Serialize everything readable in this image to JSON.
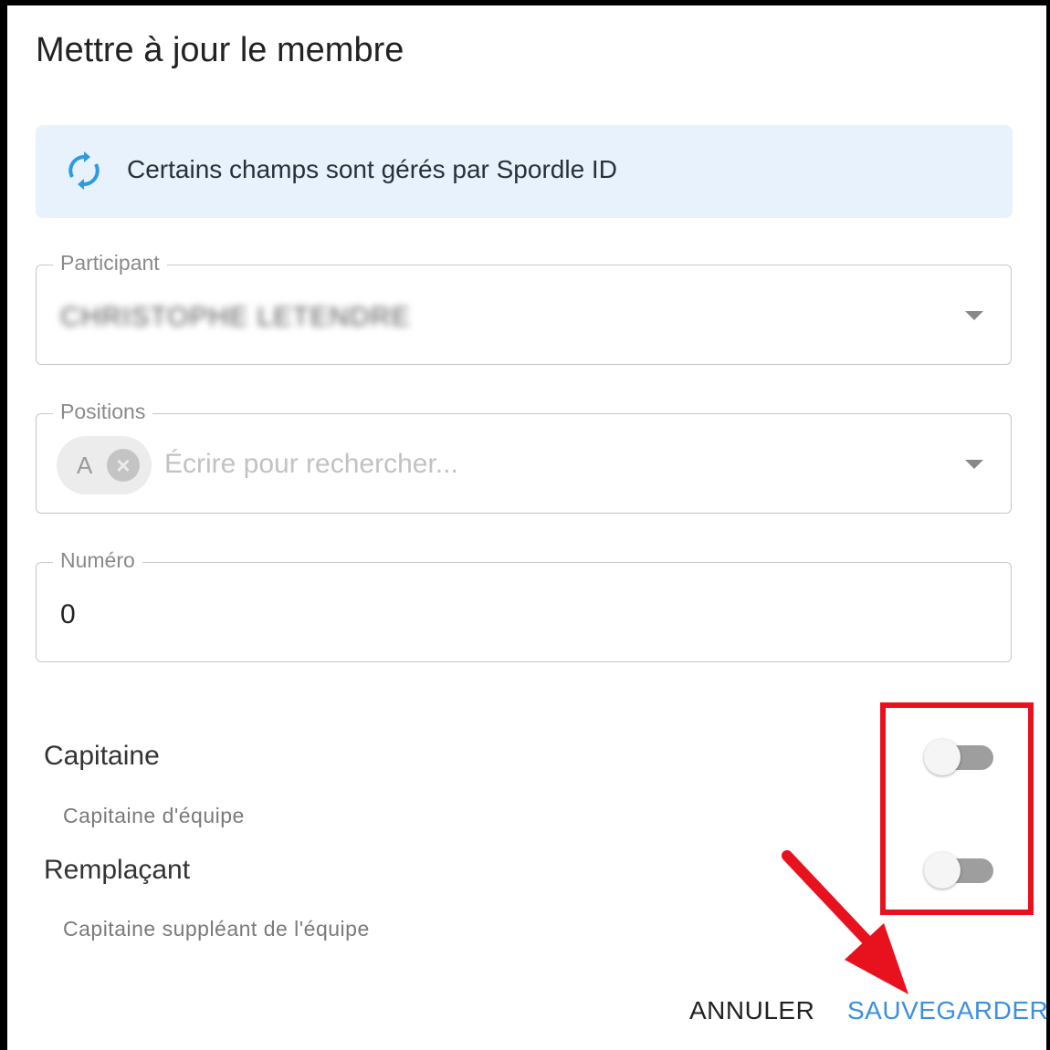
{
  "dialog": {
    "title": "Mettre à jour le membre",
    "info_banner": {
      "icon": "sync-icon",
      "text": "Certains champs sont gérés par Spordle ID"
    },
    "participant_field": {
      "label": "Participant",
      "value": "CHRISTOPHE LETENDRE"
    },
    "positions_field": {
      "label": "Positions",
      "chips": [
        "A"
      ],
      "placeholder": "Écrire pour rechercher..."
    },
    "number_field": {
      "label": "Numéro",
      "value": "0"
    },
    "captain": {
      "label": "Capitaine",
      "help": "Capitaine d'équipe",
      "enabled": false
    },
    "substitute": {
      "label": "Remplaçant",
      "help": "Capitaine suppléant de l'équipe",
      "enabled": false
    },
    "actions": {
      "cancel": "ANNULER",
      "save": "SAUVEGARDER"
    }
  },
  "colors": {
    "accent": "#3d8fe0",
    "banner_bg": "#e8f2fc",
    "annotation_red": "#e8121f"
  }
}
